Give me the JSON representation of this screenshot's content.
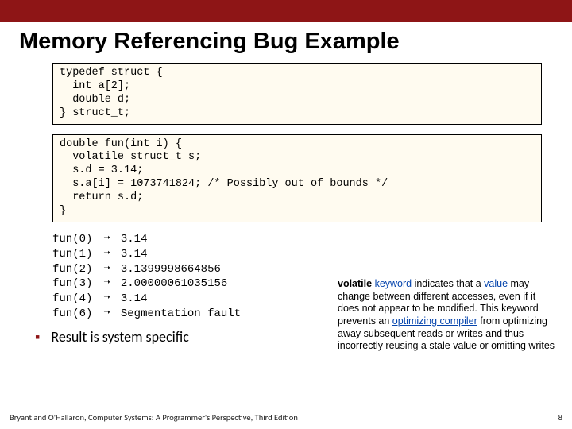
{
  "title": "Memory Referencing Bug Example",
  "code": {
    "struct": "typedef struct {\n  int a[2];\n  double d;\n} struct_t;",
    "func": "double fun(int i) {\n  volatile struct_t s;\n  s.d = 3.14;\n  s.a[i] = 1073741824; /* Possibly out of bounds */\n  return s.d;\n}"
  },
  "results": {
    "calls": [
      "fun(0)",
      "fun(1)",
      "fun(2)",
      "fun(3)",
      "fun(4)",
      "fun(6)"
    ],
    "arrow": "➝",
    "values": [
      "3.14",
      "3.14",
      "3.1399998664856",
      "2.00000061035156",
      "3.14",
      "Segmentation fault"
    ]
  },
  "note": {
    "bold": "volatile",
    "kw1": "keyword",
    "t1": " indicates that a ",
    "kw2": "value",
    "t2": " may change between different accesses, even if it does not appear to be modified. This keyword prevents an ",
    "kw3": "optimizing compiler",
    "t3": " from optimizing away subsequent reads or writes and thus incorrectly reusing a stale value or omitting writes"
  },
  "bullet": "Result is system specific",
  "footer": {
    "left": "Bryant and O'Hallaron, Computer Systems: A Programmer's Perspective, Third Edition",
    "right": "8"
  }
}
